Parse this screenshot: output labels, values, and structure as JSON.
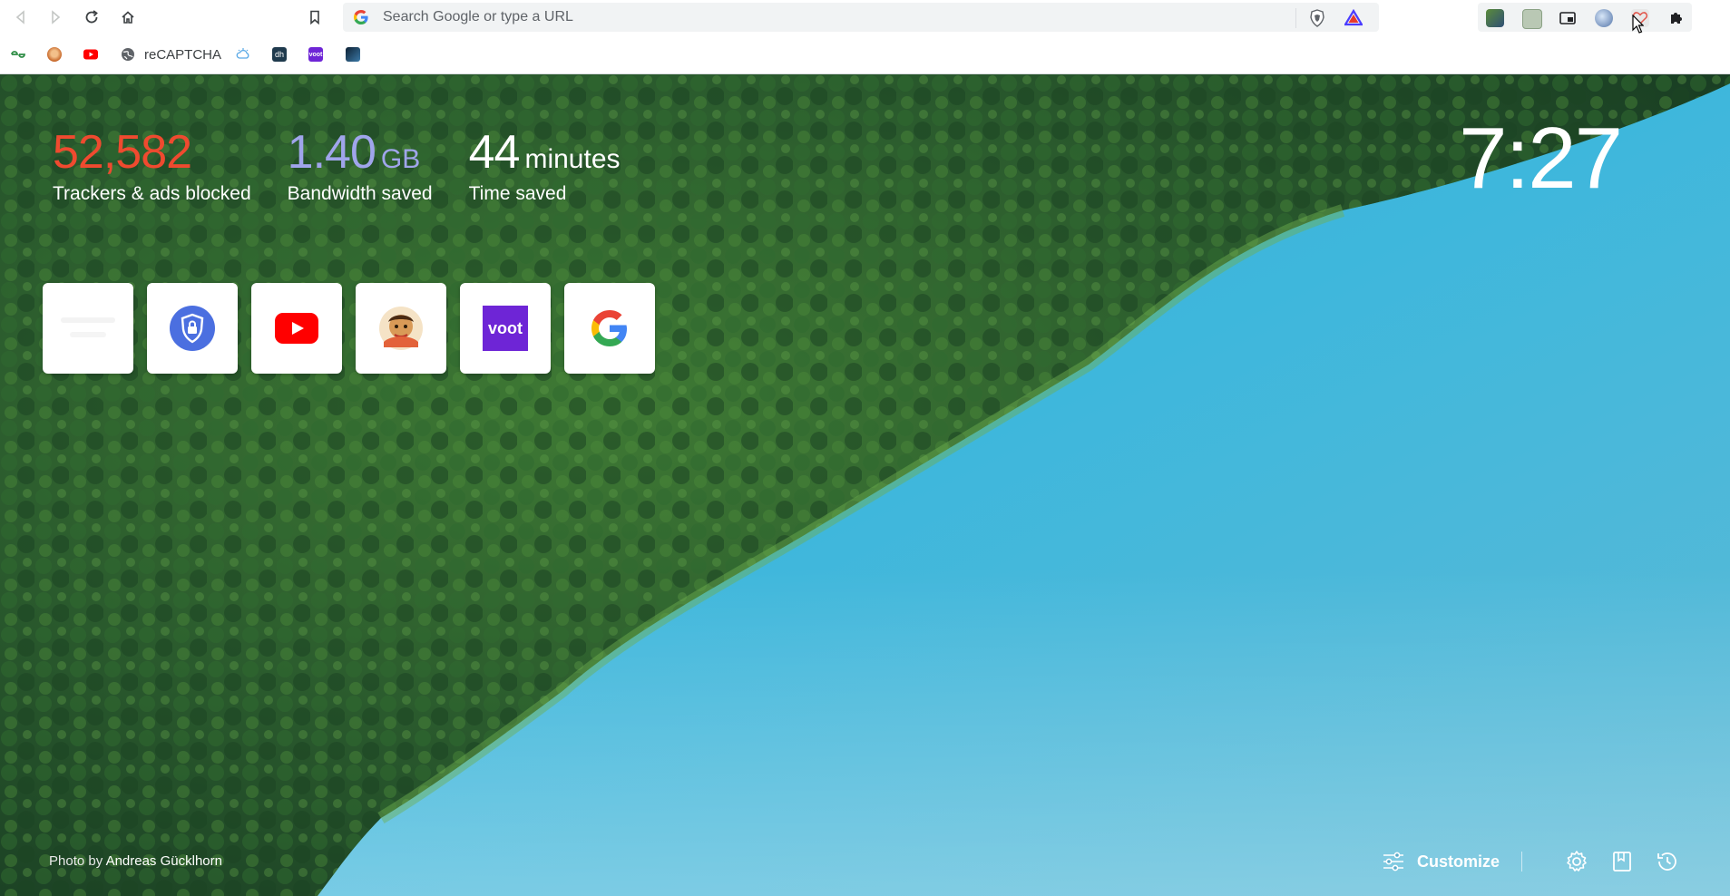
{
  "browser": {
    "omnibox_placeholder": "Search Google or type a URL",
    "bookmarks": [
      {
        "label": "",
        "icon": "geeks-icon"
      },
      {
        "label": "",
        "icon": "cartoon-avatar-icon"
      },
      {
        "label": "",
        "icon": "youtube-icon"
      },
      {
        "label": "reCAPTCHA",
        "icon": "globe-icon"
      },
      {
        "label": "",
        "icon": "cloud-icon"
      },
      {
        "label": "",
        "icon": "dh-icon"
      },
      {
        "label": "",
        "icon": "voot-icon"
      },
      {
        "label": "",
        "icon": "dark-tile-icon"
      }
    ]
  },
  "ntp": {
    "stats": {
      "trackers_value": "52,582",
      "trackers_label": "Trackers & ads blocked",
      "bandwidth_value": "1.40",
      "bandwidth_unit": "GB",
      "bandwidth_label": "Bandwidth saved",
      "time_value": "44",
      "time_unit": "minutes",
      "time_label": "Time saved"
    },
    "clock": "7:27",
    "top_sites": [
      {
        "name": "blank-site-tile"
      },
      {
        "name": "vpn-shield-tile"
      },
      {
        "name": "youtube-tile"
      },
      {
        "name": "cartoon-site-tile"
      },
      {
        "name": "voot-tile",
        "text": "voot"
      },
      {
        "name": "google-tile"
      }
    ],
    "photo_credit_prefix": "Photo by",
    "photo_credit_author": "Andreas Gücklhorn",
    "customize_label": "Customize"
  },
  "colors": {
    "trackers": "#ef4a2f",
    "bandwidth": "#a0a5eb",
    "voot": "#6e25d6",
    "water": "#3ab2d6",
    "forest": "#234f2a"
  }
}
